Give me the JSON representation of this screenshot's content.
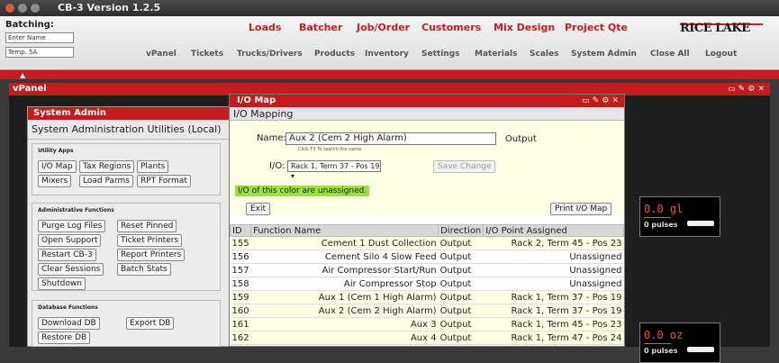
{
  "window": {
    "title": "CB-3 Version 1.2.5"
  },
  "header": {
    "batching_label": "Batching:",
    "field1": "Enter Name",
    "field2": "Temp. 5A",
    "top_links": [
      "Loads",
      "Batcher",
      "Job/Order",
      "Customers",
      "Mix Design",
      "Project Qte"
    ],
    "nav_links": [
      "vPanel",
      "Tickets",
      "Trucks/Drivers",
      "Products",
      "Inventory",
      "Settings",
      "Materials",
      "Scales",
      "System Admin",
      "Close All",
      "Logout"
    ],
    "logo": "RICE LAKE"
  },
  "vpanel": {
    "title": "vPanel",
    "gauges": [
      {
        "value": "0.0 gl",
        "pulses": "0 pulses"
      },
      {
        "value": "0.0 oz",
        "pulses": "0 pulses"
      }
    ]
  },
  "system_admin": {
    "title": "System Admin",
    "subtitle": "System Administration Utilities (Local)",
    "sections": {
      "utility": {
        "title": "Utility Apps",
        "buttons": [
          "I/O Map",
          "Tax Regions",
          "Plants",
          "Mixers",
          "Load Parms",
          "RPT Format"
        ]
      },
      "admin": {
        "title": "Administrative Functions",
        "buttons": [
          "Purge Log Files",
          "Reset Pinned",
          "Open Support",
          "Ticket Printers",
          "Restart CB-3",
          "Report Printers",
          "Clear Sessions",
          "Batch Stats",
          "Shutdown"
        ]
      },
      "database": {
        "title": "Database Functions",
        "buttons": [
          "Download DB",
          "Export DB",
          "Restore DB"
        ]
      }
    }
  },
  "io_map": {
    "title": "I/O Map",
    "section": "I/O Mapping",
    "name_label": "Name:",
    "name_value": "Aux 2 (Cem 2 High Alarm)",
    "hint": "Click F3 To search the name",
    "direction": "Output",
    "io_label": "I/O:",
    "io_value": "Rack 1, Term 37 - Pos 19",
    "save_button": "Save Change",
    "unassigned_note": "I/O of this color are unassigned.",
    "exit_button": "Exit",
    "print_button": "Print I/O Map",
    "table": {
      "headers": [
        "ID",
        "Function Name",
        "Direction",
        "I/O Point Assigned"
      ],
      "rows": [
        {
          "id": "155",
          "name": "Cement 1 Dust Collection",
          "dir": "Output",
          "point": "Rack 2, Term 45 - Pos 23",
          "unassigned": false
        },
        {
          "id": "156",
          "name": "Cement Silo 4 Slow Feed",
          "dir": "Output",
          "point": "Unassigned",
          "unassigned": true
        },
        {
          "id": "157",
          "name": "Air Compressor Start/Run",
          "dir": "Output",
          "point": "Unassigned",
          "unassigned": true
        },
        {
          "id": "158",
          "name": "Air Compressor Stop",
          "dir": "Output",
          "point": "Unassigned",
          "unassigned": true
        },
        {
          "id": "159",
          "name": "Aux 1 (Cem 1 High Alarm)",
          "dir": "Output",
          "point": "Rack 1, Term 37 - Pos 19",
          "unassigned": false
        },
        {
          "id": "160",
          "name": "Aux 2 (Cem 2 High Alarm)",
          "dir": "Output",
          "point": "Rack 1, Term 37 - Pos 19",
          "unassigned": false
        },
        {
          "id": "161",
          "name": "Aux 3",
          "dir": "Output",
          "point": "Rack 1, Term 45 - Pos 23",
          "unassigned": false
        },
        {
          "id": "162",
          "name": "Aux 4",
          "dir": "Output",
          "point": "Rack 1, Term 47 - Pos 24",
          "unassigned": false
        }
      ]
    }
  },
  "colors": {
    "accent": "#c41c1c",
    "unassigned": "#99e040",
    "form_bg": "#ffffe6"
  }
}
